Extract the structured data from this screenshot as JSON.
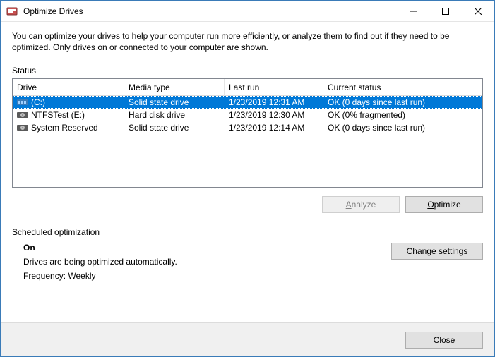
{
  "window": {
    "title": "Optimize Drives"
  },
  "intro": "You can optimize your drives to help your computer run more efficiently, or analyze them to find out if they need to be optimized. Only drives on or connected to your computer are shown.",
  "status_label": "Status",
  "columns": {
    "drive": "Drive",
    "media": "Media type",
    "last": "Last run",
    "status": "Current status"
  },
  "drives": [
    {
      "name": " (C:)",
      "media": "Solid state drive",
      "last": "1/23/2019 12:31 AM",
      "status": "OK (0 days since last run)",
      "icon": "ssd",
      "selected": true
    },
    {
      "name": "NTFSTest (E:)",
      "media": "Hard disk drive",
      "last": "1/23/2019 12:30 AM",
      "status": "OK (0% fragmented)",
      "icon": "hdd",
      "selected": false
    },
    {
      "name": "System Reserved",
      "media": "Solid state drive",
      "last": "1/23/2019 12:14 AM",
      "status": "OK (0 days since last run)",
      "icon": "hdd",
      "selected": false
    }
  ],
  "buttons": {
    "analyze": "Analyze",
    "optimize": "Optimize",
    "change_settings": "Change settings",
    "close": "Close"
  },
  "schedule": {
    "label": "Scheduled optimization",
    "state": "On",
    "desc": "Drives are being optimized automatically.",
    "freq": "Frequency: Weekly"
  }
}
